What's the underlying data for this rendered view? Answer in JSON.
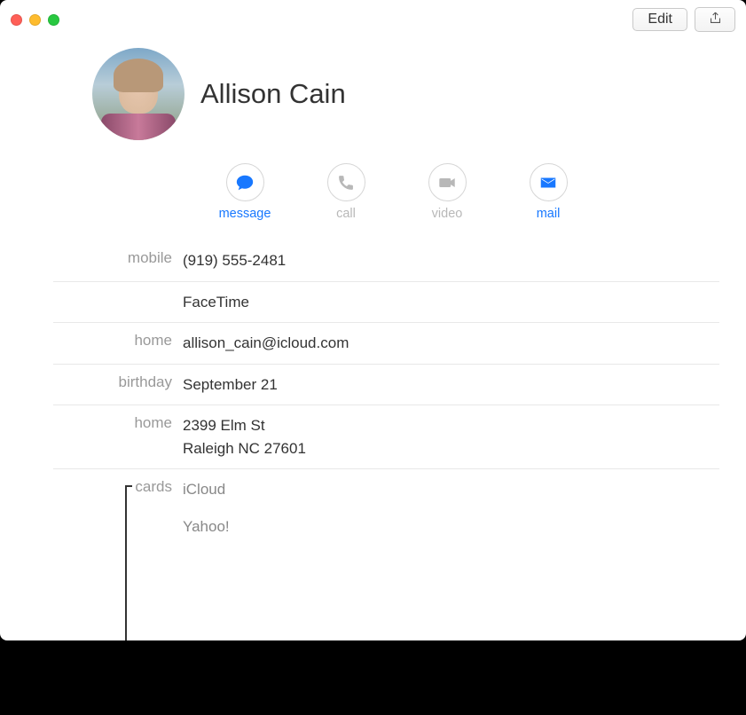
{
  "toolbar": {
    "edit_label": "Edit"
  },
  "contact": {
    "name": "Allison Cain"
  },
  "actions": {
    "message": "message",
    "call": "call",
    "video": "video",
    "mail": "mail"
  },
  "fields": {
    "mobile_label": "mobile",
    "mobile_value": "(919) 555-2481",
    "facetime_label": "",
    "facetime_value": "FaceTime",
    "home_email_label": "home",
    "home_email_value": "allison_cain@icloud.com",
    "birthday_label": "birthday",
    "birthday_value": "September 21",
    "home_addr_label": "home",
    "home_addr_value": "2399 Elm St\nRaleigh NC 27601",
    "cards_label": "cards",
    "cards_value_1": "iCloud",
    "cards_value_2": "Yahoo!"
  }
}
